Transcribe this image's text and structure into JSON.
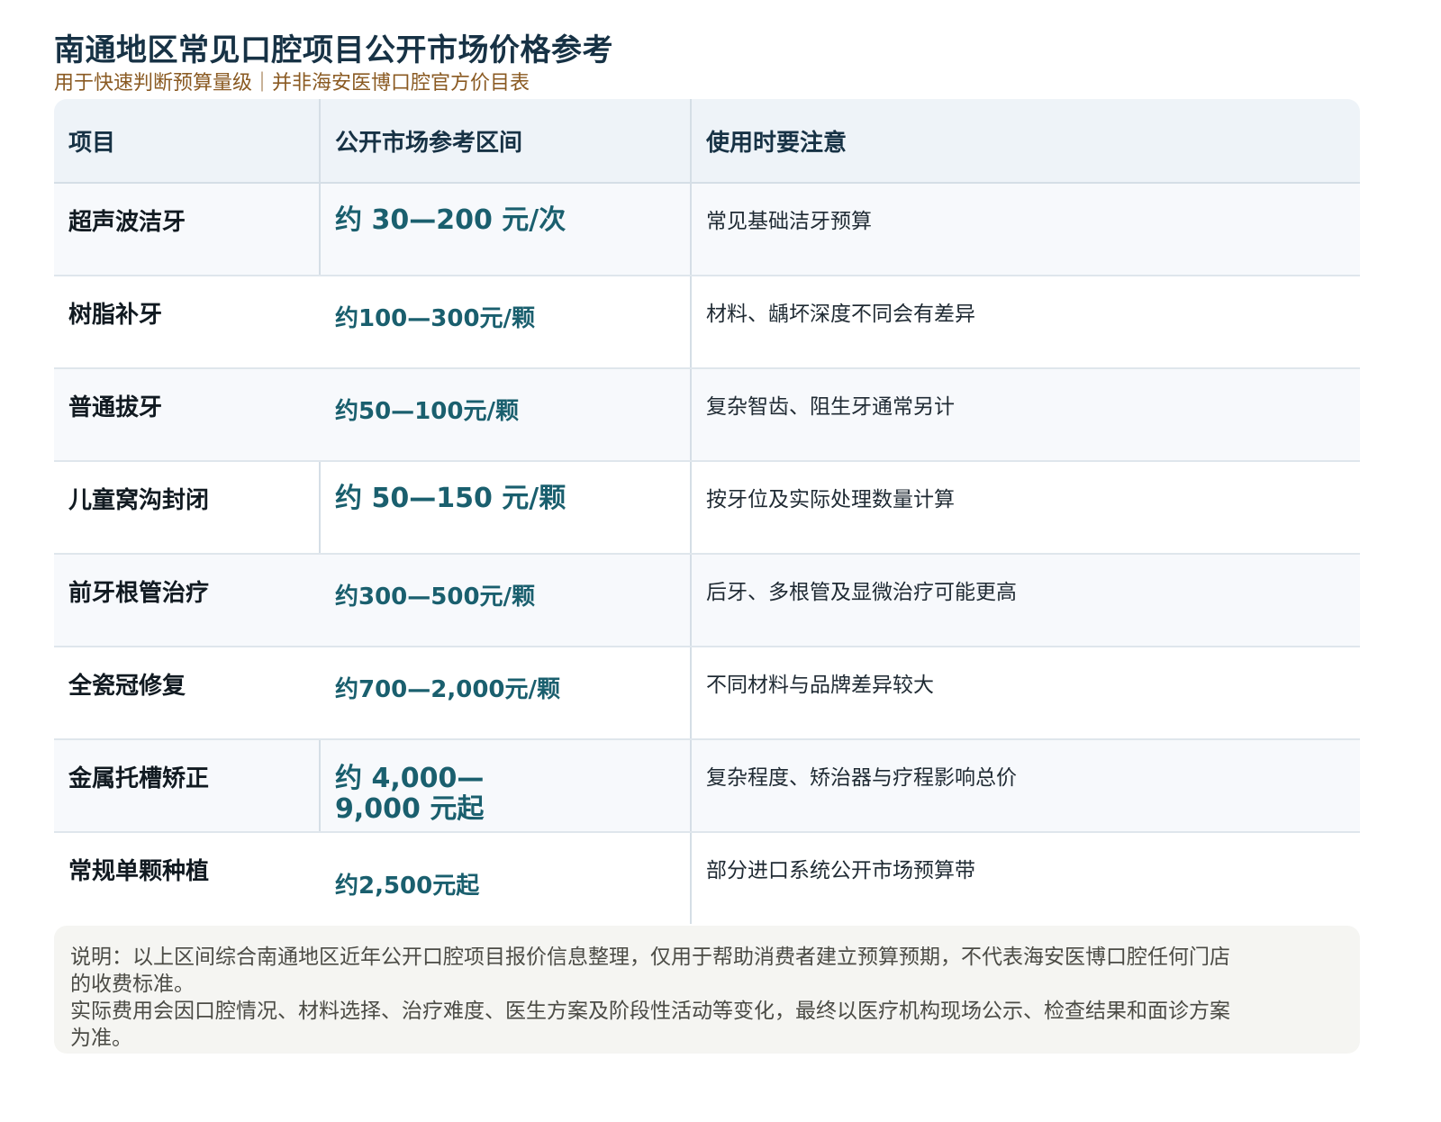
{
  "title": "南通地区常见口腔项目公开市场价格参考",
  "subtitle": "用于快速判断预算量级｜并非海安医博口腔官方价目表",
  "table": {
    "headers": [
      "项目",
      "公开市场参考区间",
      "使用时要注意"
    ],
    "rows": [
      {
        "item": "超声波洁牙",
        "price": "约 30—200 元/次",
        "note": "常见基础洁牙预算"
      },
      {
        "item": "树脂补牙",
        "price": "约100—300元/颗",
        "note": "材料、龋坏深度不同会有差异"
      },
      {
        "item": "普通拔牙",
        "price": "约50—100元/颗",
        "note": "复杂智齿、阻生牙通常另计"
      },
      {
        "item": "儿童窝沟封闭",
        "price": "约 50—150 元/颗",
        "note": "按牙位及实际处理数量计算"
      },
      {
        "item": "前牙根管治疗",
        "price": "约300—500元/颗",
        "note": "后牙、多根管及显微治疗可能更高"
      },
      {
        "item": "全瓷冠修复",
        "price": "约700—2,000元/颗",
        "note": "不同材料与品牌差异较大"
      },
      {
        "item": "金属托槽矫正",
        "price": "约 4,000—9,000 元起",
        "note": "复杂程度、矫治器与疗程影响总价"
      },
      {
        "item": "常规单颗种植",
        "price": "约2,500元起",
        "note": "部分进口系统公开市场预算带"
      }
    ]
  },
  "footnote": {
    "line1": "说明：以上区间综合南通地区近年公开口腔项目报价信息整理，仅用于帮助消费者建立预算预期，不代表海安医博口腔任何门店的收费标准。",
    "line2": "实际费用会因口腔情况、材料选择、治疗难度、医生方案及阶段性活动等变化，最终以医疗机构现场公示、检查结果和面诊方案为准。"
  }
}
